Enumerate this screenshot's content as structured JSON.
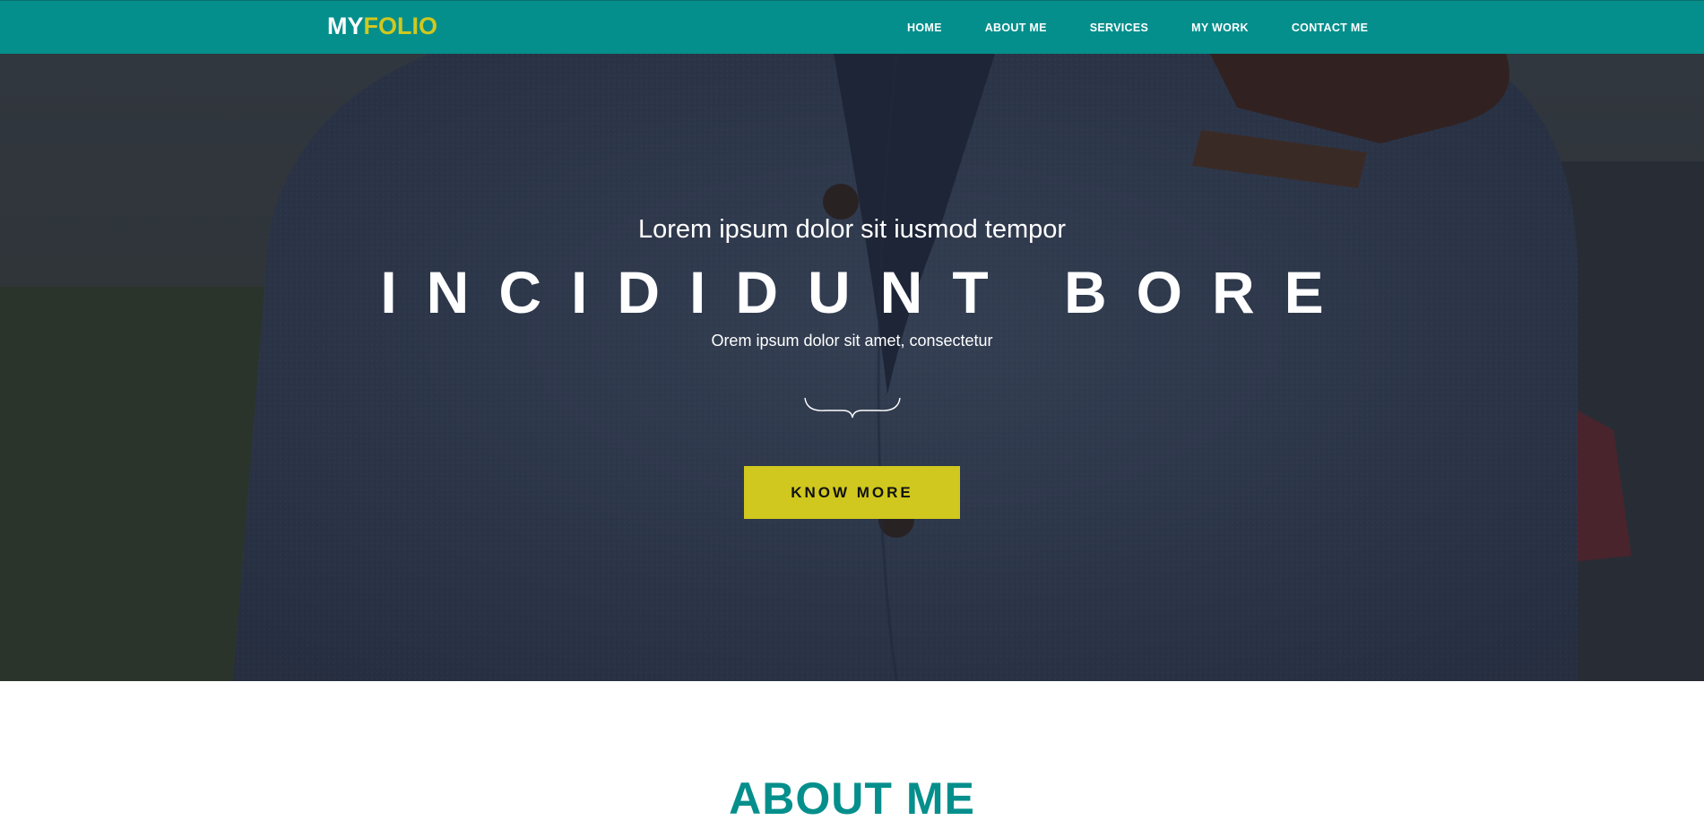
{
  "colors": {
    "primary": "#058f8c",
    "accent": "#d0c81e"
  },
  "nav": {
    "logo_left": "MY",
    "logo_right": "FOLIO",
    "links": [
      "HOME",
      "ABOUT ME",
      "SERVICES",
      "MY WORK",
      "CONTACT ME"
    ]
  },
  "hero": {
    "subtitle": "Lorem ipsum dolor sit iusmod tempor",
    "title": "INCIDIDUNT BORE",
    "description": "Orem ipsum dolor sit amet, consectetur",
    "divider_icon": "curly-brace-divider-icon",
    "button_label": "KNOW MORE"
  },
  "about": {
    "title": "ABOUT ME"
  }
}
